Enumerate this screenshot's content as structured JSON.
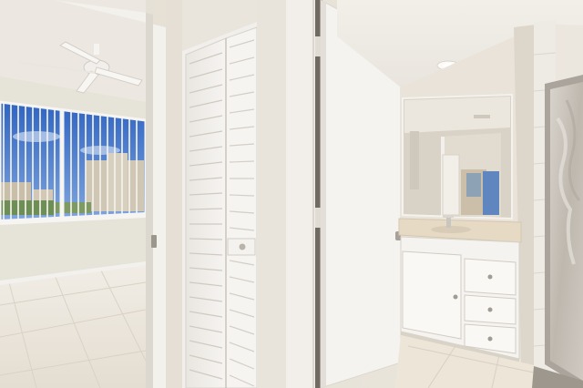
{
  "scene": {
    "description_tag": "interior-hallway-bathroom-photo",
    "colors": {
      "wall": "#e7e1d7",
      "trim": "#f4f2ee",
      "tile": "#ece7de",
      "sky": "#3f74c9",
      "vanity_top": "#e6dac4",
      "shower_glass": "#c9c3bc"
    }
  }
}
